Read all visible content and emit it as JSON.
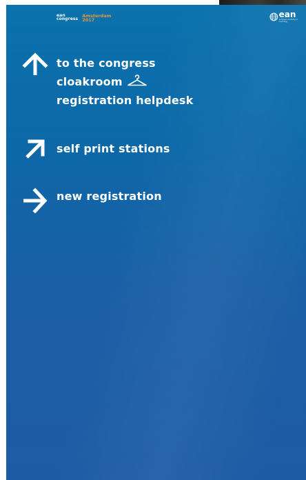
{
  "logo": {
    "congress": {
      "line1": "ean",
      "line2": "congress",
      "city": "Amsterdam",
      "year": "2017"
    },
    "organization": {
      "name": "ean",
      "tagline": "european academy of neurology"
    }
  },
  "directions": [
    {
      "arrow": "arrow-up-icon",
      "labels": [
        "to the congress",
        "cloakroom",
        "registration helpdesk"
      ],
      "extra_icon": "coat-hanger-icon"
    },
    {
      "arrow": "arrow-up-right-icon",
      "labels": [
        "self print stations"
      ]
    },
    {
      "arrow": "arrow-right-icon",
      "labels": [
        "new registration"
      ]
    }
  ],
  "colors": {
    "background_top": "#0a72ad",
    "background_bottom": "#1e5ba5",
    "text": "#ffffff",
    "accent": "#e8973a"
  }
}
